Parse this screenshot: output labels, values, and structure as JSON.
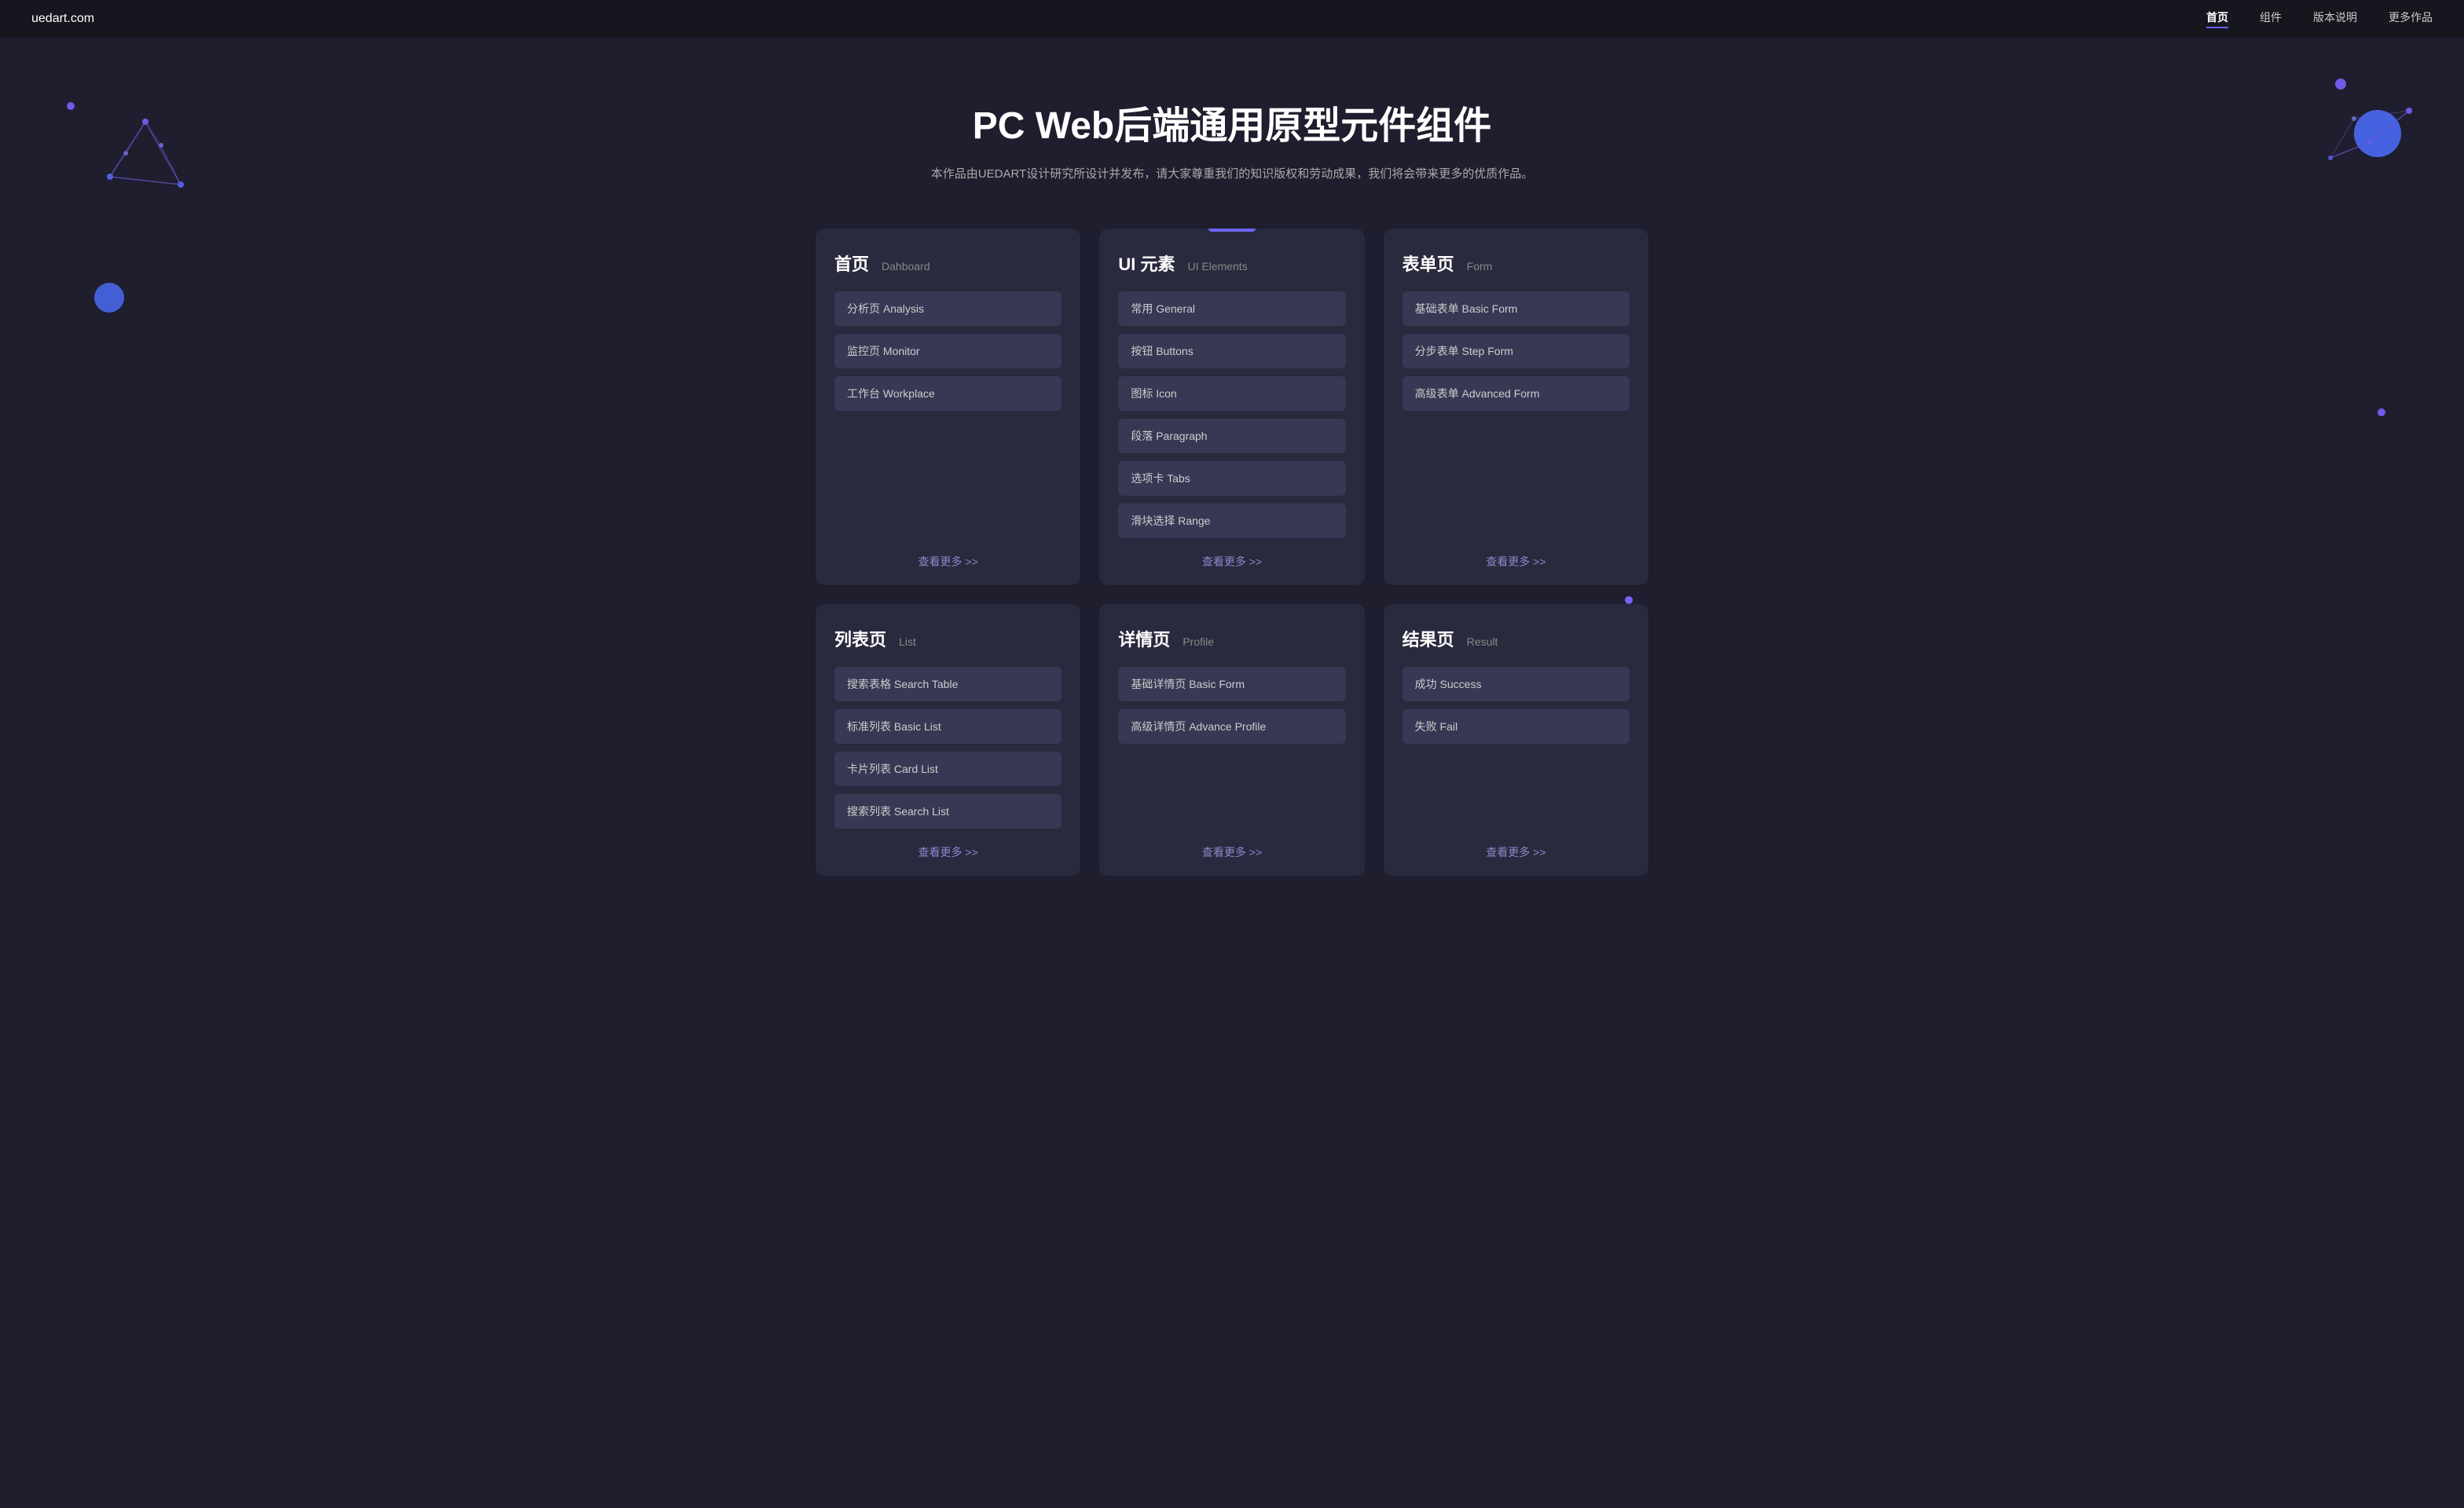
{
  "nav": {
    "logo": "uedart.com",
    "links": [
      {
        "label": "首页",
        "active": true
      },
      {
        "label": "组件",
        "active": false
      },
      {
        "label": "版本说明",
        "active": false
      },
      {
        "label": "更多作品",
        "active": false
      }
    ]
  },
  "hero": {
    "title": "PC Web后端通用原型元件组件",
    "subtitle": "本作品由UEDART设计研究所设计并发布，请大家尊重我们的知识版权和劳动成果，我们将会带来更多的优质作品。"
  },
  "cards": [
    {
      "id": "home",
      "title_cn": "首页",
      "title_en": "Dahboard",
      "items": [
        {
          "label": "分析页 Analysis"
        },
        {
          "label": "监控页 Monitor"
        },
        {
          "label": "工作台 Workplace"
        }
      ],
      "more": "查看更多 >>"
    },
    {
      "id": "ui",
      "title_cn": "UI 元素",
      "title_en": "UI Elements",
      "items": [
        {
          "label": "常用 General"
        },
        {
          "label": "按钮 Buttons"
        },
        {
          "label": "图标 Icon"
        },
        {
          "label": "段落 Paragraph"
        },
        {
          "label": "选项卡 Tabs"
        },
        {
          "label": "滑块选择 Range"
        }
      ],
      "more": "查看更多 >>"
    },
    {
      "id": "form",
      "title_cn": "表单页",
      "title_en": "Form",
      "items": [
        {
          "label": "基础表单 Basic Form"
        },
        {
          "label": "分步表单 Step Form"
        },
        {
          "label": "高级表单 Advanced Form"
        }
      ],
      "more": "查看更多 >>"
    },
    {
      "id": "list",
      "title_cn": "列表页",
      "title_en": "List",
      "items": [
        {
          "label": "搜索表格 Search Table"
        },
        {
          "label": "标准列表 Basic List"
        },
        {
          "label": "卡片列表 Card List"
        },
        {
          "label": "搜索列表 Search List"
        }
      ],
      "more": "查看更多 >>"
    },
    {
      "id": "detail",
      "title_cn": "详情页",
      "title_en": "Profile",
      "items": [
        {
          "label": "基础详情页 Basic Form"
        },
        {
          "label": "高级详情页 Advance Profile"
        }
      ],
      "more": "查看更多 >>"
    },
    {
      "id": "result",
      "title_cn": "结果页",
      "title_en": "Result",
      "items": [
        {
          "label": "成功 Success"
        },
        {
          "label": "失败 Fail"
        }
      ],
      "more": "查看更多 >>"
    }
  ]
}
